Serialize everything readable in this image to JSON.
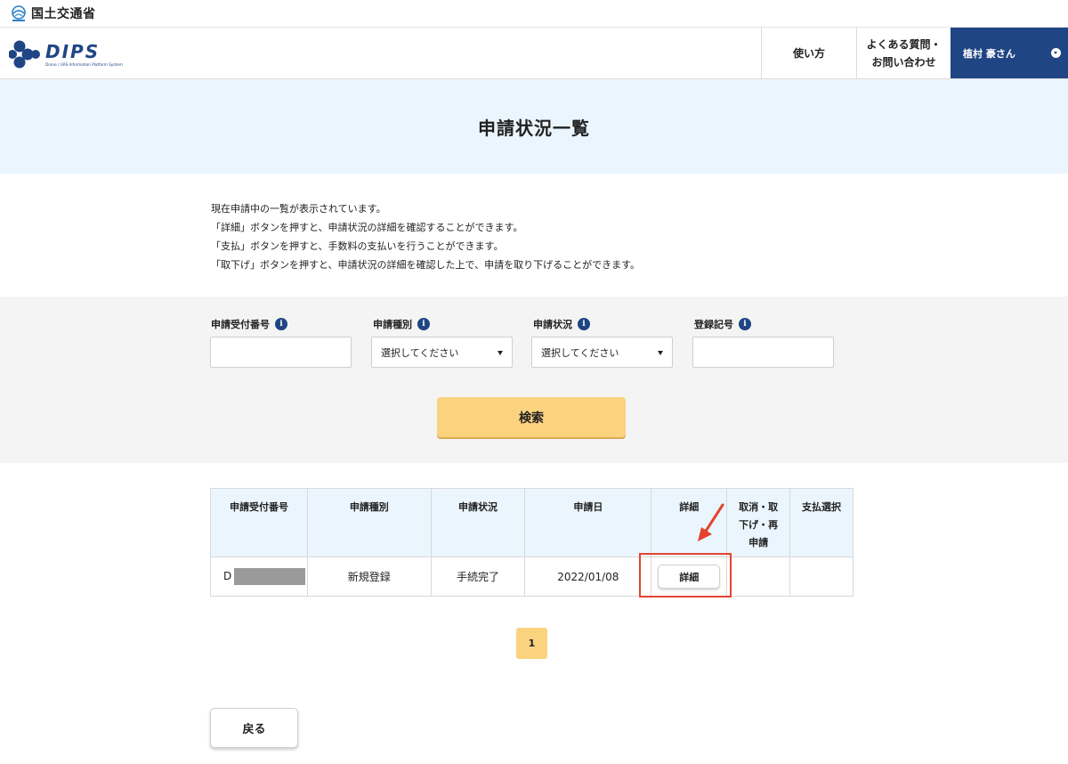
{
  "ministry": {
    "name": "国土交通省",
    "icon": "ministry-emblem-icon"
  },
  "header": {
    "logo_text": "DIPS",
    "logo_subtitle": "Drone / UAS Information Platform System",
    "nav_howto": "使い方",
    "nav_faq_line1": "よくある質問・",
    "nav_faq_line2": "お問い合わせ",
    "user_name": "植村 豪さん",
    "colors": {
      "user_bg": "#1f4584",
      "logo_blue": "#1f4584"
    }
  },
  "page": {
    "title": "申請状況一覧"
  },
  "description": [
    "現在申請中の一覧が表示されています。",
    "「詳細」ボタンを押すと、申請状況の詳細を確認することができます。",
    "「支払」ボタンを押すと、手数料の支払いを行うことができます。",
    "「取下げ」ボタンを押すと、申請状況の詳細を確認した上で、申請を取り下げることができます。"
  ],
  "search": {
    "receipt_no_label": "申請受付番号",
    "receipt_no_value": "",
    "type_label": "申請種別",
    "type_selected": "選択してください",
    "status_label": "申請状況",
    "status_selected": "選択してください",
    "reg_no_label": "登録記号",
    "reg_no_value": "",
    "info_glyph": "i",
    "button": "検索",
    "colors": {
      "button_bg": "#fbd27e",
      "info_icon": "#1f4584"
    }
  },
  "table": {
    "headers": {
      "receipt_no": "申請受付番号",
      "type": "申請種別",
      "status": "申請状況",
      "date": "申請日",
      "detail": "詳細",
      "cancel_line1": "取消・取",
      "cancel_line2": "下げ・再",
      "cancel_line3": "申請",
      "payment": "支払選択"
    },
    "rows": [
      {
        "receipt_no_prefix": "D",
        "type": "新規登録",
        "status": "手続完了",
        "date": "2022/01/08",
        "detail_button": "詳細",
        "cancel": "",
        "payment": ""
      }
    ],
    "colors": {
      "header_bg": "#eaf5fd",
      "border": "#d9d9d9"
    }
  },
  "annotation": {
    "color": "#e4442e"
  },
  "pagination": {
    "current": "1"
  },
  "back_button": "戻る"
}
